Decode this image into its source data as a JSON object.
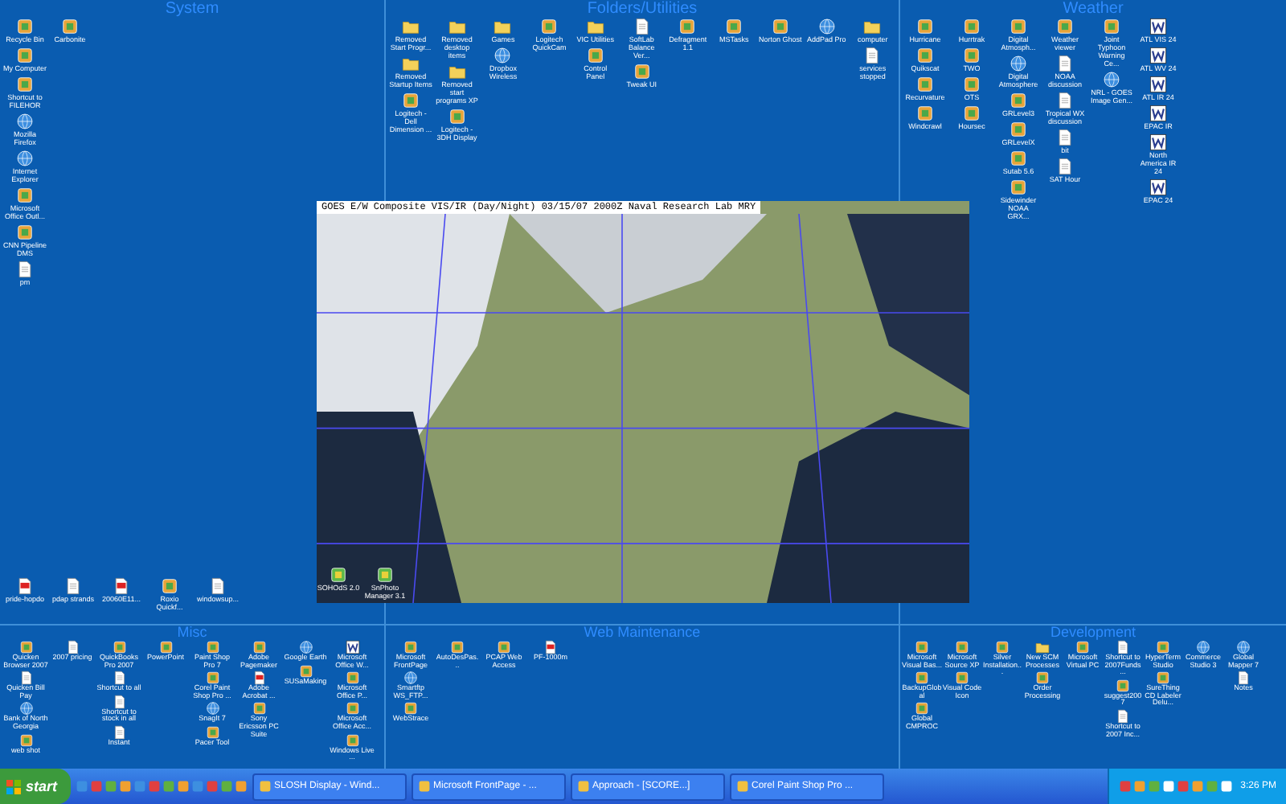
{
  "top_sections": [
    {
      "title": "System",
      "columns": [
        [
          {
            "label": "Recycle Bin",
            "kind": "program"
          },
          {
            "label": "My Computer",
            "kind": "program"
          },
          {
            "label": "Shortcut to FILEHOR",
            "kind": "program"
          },
          {
            "label": "Mozilla Firefox",
            "kind": "globe"
          },
          {
            "label": "Internet Explorer",
            "kind": "globe"
          },
          {
            "label": "Microsoft Office Outl...",
            "kind": "program"
          },
          {
            "label": "CNN Pipeline DMS",
            "kind": "program"
          },
          {
            "label": "pm",
            "kind": "document"
          }
        ],
        [
          {
            "label": "Carbonite",
            "kind": "program"
          }
        ]
      ],
      "bottom_icons": [
        {
          "label": "pride-hopdo",
          "kind": "pdf"
        },
        {
          "label": "pdap strands",
          "kind": "document"
        },
        {
          "label": "20060E11...",
          "kind": "pdf"
        },
        {
          "label": "Roxio Quickf...",
          "kind": "program"
        },
        {
          "label": "windowsup...",
          "kind": "document"
        }
      ]
    },
    {
      "title": "Folders/Utilities",
      "columns": [
        [
          {
            "label": "Removed Start Progr...",
            "kind": "folder"
          },
          {
            "label": "Removed Startup Items",
            "kind": "folder"
          },
          {
            "label": "Logitech - Dell Dimension ...",
            "kind": "program"
          }
        ],
        [
          {
            "label": "Removed desktop items",
            "kind": "folder"
          },
          {
            "label": "Removed start programs XP",
            "kind": "folder"
          },
          {
            "label": "Logitech - 3DH Display",
            "kind": "program"
          }
        ],
        [
          {
            "label": "Games",
            "kind": "folder"
          },
          {
            "label": "Dropbox Wireless",
            "kind": "globe"
          }
        ],
        [
          {
            "label": "Logitech QuickCam",
            "kind": "program"
          }
        ],
        [
          {
            "label": "VIC Utilities",
            "kind": "folder"
          },
          {
            "label": "Control Panel",
            "kind": "program"
          }
        ],
        [
          {
            "label": "SoftLab Balance Ver...",
            "kind": "document"
          },
          {
            "label": "Tweak UI",
            "kind": "program"
          }
        ],
        [
          {
            "label": "Defragment 1.1",
            "kind": "program"
          }
        ],
        [
          {
            "label": "MSTasks",
            "kind": "program"
          }
        ],
        [
          {
            "label": "Norton Ghost",
            "kind": "program"
          }
        ],
        [
          {
            "label": "AddPad Pro",
            "kind": "globe"
          }
        ],
        [
          {
            "label": "computer",
            "kind": "folder"
          },
          {
            "label": "services stopped",
            "kind": "document"
          }
        ]
      ]
    },
    {
      "title": "Weather",
      "columns": [
        [
          {
            "label": "Hurricane",
            "kind": "program"
          },
          {
            "label": "Quikscat",
            "kind": "program"
          },
          {
            "label": "Recurvature",
            "kind": "program"
          },
          {
            "label": "Windcrawl",
            "kind": "program"
          }
        ],
        [
          {
            "label": "Hurrtrak",
            "kind": "program"
          },
          {
            "label": "TWO",
            "kind": "program"
          },
          {
            "label": "OTS",
            "kind": "program"
          },
          {
            "label": "Hoursec",
            "kind": "program"
          }
        ],
        [
          {
            "label": "Digital Atmosph...",
            "kind": "program"
          },
          {
            "label": "Digital Atmosphere",
            "kind": "globe"
          },
          {
            "label": "GRLevel3",
            "kind": "program"
          },
          {
            "label": "GRLevelX",
            "kind": "program"
          },
          {
            "label": "Sutab 5.6",
            "kind": "program"
          },
          {
            "label": "Sidewinder NOAA GRX...",
            "kind": "program"
          }
        ],
        [
          {
            "label": "Weather viewer",
            "kind": "program"
          },
          {
            "label": "NOAA discussion",
            "kind": "document"
          },
          {
            "label": "Tropical WX discussion",
            "kind": "document"
          },
          {
            "label": "bit",
            "kind": "document"
          },
          {
            "label": "SAT Hour",
            "kind": "document"
          }
        ],
        [
          {
            "label": "Joint Typhoon Warning Ce...",
            "kind": "program"
          },
          {
            "label": "NRL - GOES Image Gen...",
            "kind": "globe"
          }
        ],
        [
          {
            "label": "ATL VIS 24",
            "kind": "word"
          },
          {
            "label": "ATL WV 24",
            "kind": "word"
          },
          {
            "label": "ATL IR 24",
            "kind": "word"
          },
          {
            "label": "EPAC IR",
            "kind": "word"
          },
          {
            "label": "North America IR 24",
            "kind": "word"
          },
          {
            "label": "EPAC 24",
            "kind": "word"
          }
        ]
      ]
    }
  ],
  "satellite_image": {
    "caption": "GOES E/W Composite VIS/IR (Day/Night) 03/15/07 2000Z Naval Research Lab MRY",
    "overlaid_icons": [
      {
        "label": "SOHOdS 2.0",
        "kind": "program"
      },
      {
        "label": "SnPhoto Manager 3.1",
        "kind": "program"
      }
    ]
  },
  "bottom_sections": [
    {
      "title": "Misc",
      "columns": [
        [
          {
            "label": "Quicken Browser 2007",
            "kind": "program"
          },
          {
            "label": "Quicken Bill Pay",
            "kind": "document"
          },
          {
            "label": "Bank of North Georgia",
            "kind": "globe"
          },
          {
            "label": "web shot",
            "kind": "program"
          }
        ],
        [
          {
            "label": "2007 pricing",
            "kind": "document"
          }
        ],
        [
          {
            "label": "QuickBooks Pro 2007",
            "kind": "program"
          },
          {
            "label": "Shortcut to all",
            "kind": "document"
          },
          {
            "label": "Shortcut to stock in all",
            "kind": "document"
          },
          {
            "label": "Instant",
            "kind": "document"
          }
        ],
        [
          {
            "label": "PowerPoint",
            "kind": "program"
          }
        ],
        [
          {
            "label": "Paint Shop Pro 7",
            "kind": "program"
          },
          {
            "label": "Corel Paint Shop Pro ...",
            "kind": "program"
          },
          {
            "label": "SnagIt 7",
            "kind": "globe"
          },
          {
            "label": "Pacer Tool",
            "kind": "program"
          }
        ],
        [
          {
            "label": "Adobe Pagemaker",
            "kind": "program"
          },
          {
            "label": "Adobe Acrobat ...",
            "kind": "pdf"
          },
          {
            "label": "Sony Ericsson PC Suite",
            "kind": "program"
          }
        ],
        [
          {
            "label": "Google Earth",
            "kind": "globe"
          },
          {
            "label": "SUSaMaking",
            "kind": "program"
          }
        ],
        [
          {
            "label": "Microsoft Office W...",
            "kind": "word"
          },
          {
            "label": "Microsoft Office P...",
            "kind": "program"
          },
          {
            "label": "Microsoft Office Acc...",
            "kind": "program"
          },
          {
            "label": "Windows Live ...",
            "kind": "program"
          }
        ]
      ]
    },
    {
      "title": "Web Maintenance",
      "columns": [
        [
          {
            "label": "Microsoft FrontPage",
            "kind": "program"
          },
          {
            "label": "Smartftp WS_FTP...",
            "kind": "globe"
          },
          {
            "label": "WebStrace",
            "kind": "program"
          }
        ],
        [
          {
            "label": "AutoDesPas...",
            "kind": "program"
          }
        ],
        [
          {
            "label": "PCAP Web Access",
            "kind": "program"
          }
        ],
        [
          {
            "label": "PF-1000m",
            "kind": "pdf"
          }
        ]
      ]
    },
    {
      "title": "Development",
      "columns": [
        [
          {
            "label": "Microsoft Visual Bas...",
            "kind": "program"
          },
          {
            "label": "BackupGlobal",
            "kind": "program"
          },
          {
            "label": "Global CMPROC",
            "kind": "program"
          }
        ],
        [
          {
            "label": "Microsoft Source XP",
            "kind": "program"
          },
          {
            "label": "Visual Code Icon",
            "kind": "program"
          }
        ],
        [
          {
            "label": "Silver Installation...",
            "kind": "program"
          }
        ],
        [
          {
            "label": "New SCM Processes",
            "kind": "folder"
          },
          {
            "label": "Order Processing",
            "kind": "program"
          }
        ],
        [
          {
            "label": "Microsoft Virtual PC",
            "kind": "program"
          }
        ],
        [
          {
            "label": "Shortcut to 2007Funds ...",
            "kind": "document"
          },
          {
            "label": "suggest2007",
            "kind": "program"
          },
          {
            "label": "Shortcut to 2007 Inc...",
            "kind": "document"
          }
        ],
        [
          {
            "label": "HyperTerm Studio",
            "kind": "program"
          },
          {
            "label": "SureThing CD Labeler Delu...",
            "kind": "program"
          }
        ],
        [
          {
            "label": "Commerce Studio 3",
            "kind": "globe"
          }
        ],
        [
          {
            "label": "Global Mapper 7",
            "kind": "globe"
          },
          {
            "label": "Notes",
            "kind": "document"
          }
        ]
      ]
    }
  ],
  "taskbar": {
    "start_label": "start",
    "tasks": [
      {
        "label": "SLOSH Display - Wind...",
        "selected": false
      },
      {
        "label": "Microsoft FrontPage - ...",
        "selected": false
      },
      {
        "label": "Approach - [SCORE...]",
        "selected": false
      },
      {
        "label": "Corel Paint Shop Pro ...",
        "selected": false
      }
    ],
    "clock": "3:26 PM"
  }
}
